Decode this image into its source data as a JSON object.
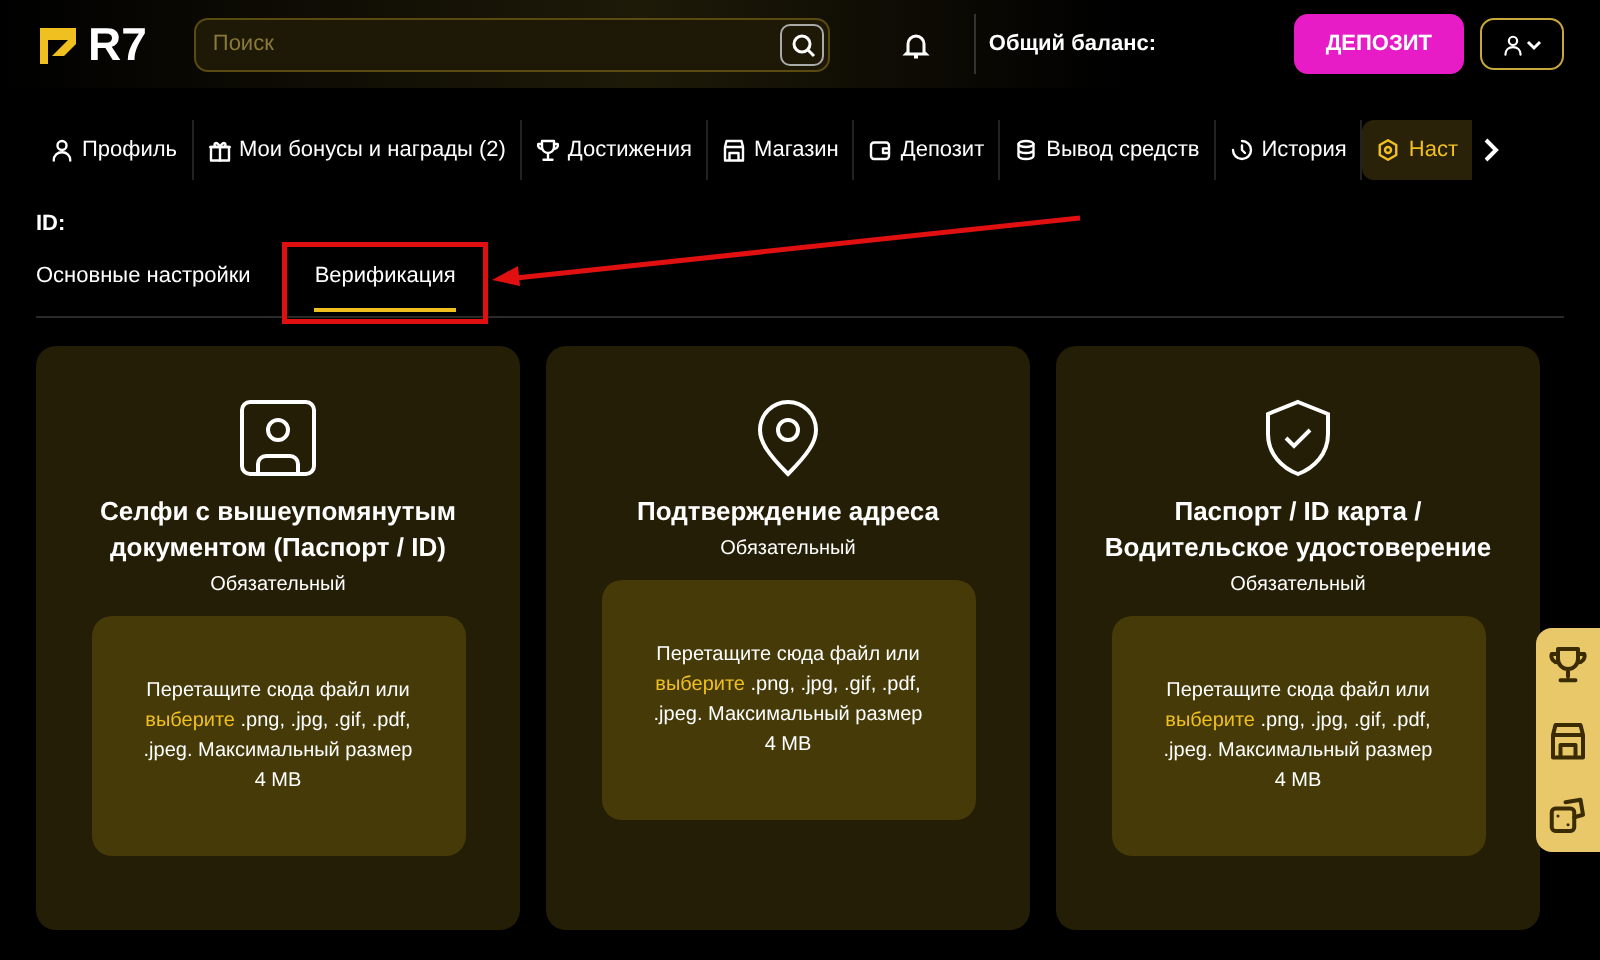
{
  "header": {
    "logo": "R7",
    "search": {
      "placeholder": "Поиск"
    },
    "balance_label": "Общий баланс:",
    "deposit_button": "ДЕПОЗИТ"
  },
  "nav": [
    {
      "label": "Профиль",
      "selected": false
    },
    {
      "label": "Мои бонусы и награды (2)",
      "selected": false
    },
    {
      "label": "Достижения",
      "selected": false
    },
    {
      "label": "Магазин",
      "selected": false
    },
    {
      "label": "Депозит",
      "selected": false
    },
    {
      "label": "Вывод средств",
      "selected": false
    },
    {
      "label": "История",
      "selected": false
    },
    {
      "label": "Наст",
      "selected": true
    }
  ],
  "id_label": "ID:",
  "tabs": [
    {
      "label": "Основные настройки",
      "selected": false
    },
    {
      "label": "Верификация",
      "selected": true
    }
  ],
  "cards": [
    {
      "title": "Селфи с вышеупомянутым документом (Паспорт / ID)",
      "subtitle": "Обязательный",
      "drop_before": "Перетащите сюда файл или",
      "drop_link": "выберите",
      "drop_after": ".png, .jpg, .gif, .pdf, .jpeg. Максимальный размер 4 MB"
    },
    {
      "title": "Подтверждение адреса",
      "subtitle": "Обязательный",
      "drop_before": "Перетащите сюда файл или",
      "drop_link": "выберите",
      "drop_after": ".png, .jpg, .gif, .pdf, .jpeg. Максимальный размер 4 MB"
    },
    {
      "title": "Паспорт / ID карта / Водительское удостоверение",
      "subtitle": "Обязательный",
      "drop_before": "Перетащите сюда файл или",
      "drop_link": "выберите",
      "drop_after": ".png, .jpg, .gif, .pdf, .jpeg. Максимальный размер 4 MB"
    }
  ]
}
